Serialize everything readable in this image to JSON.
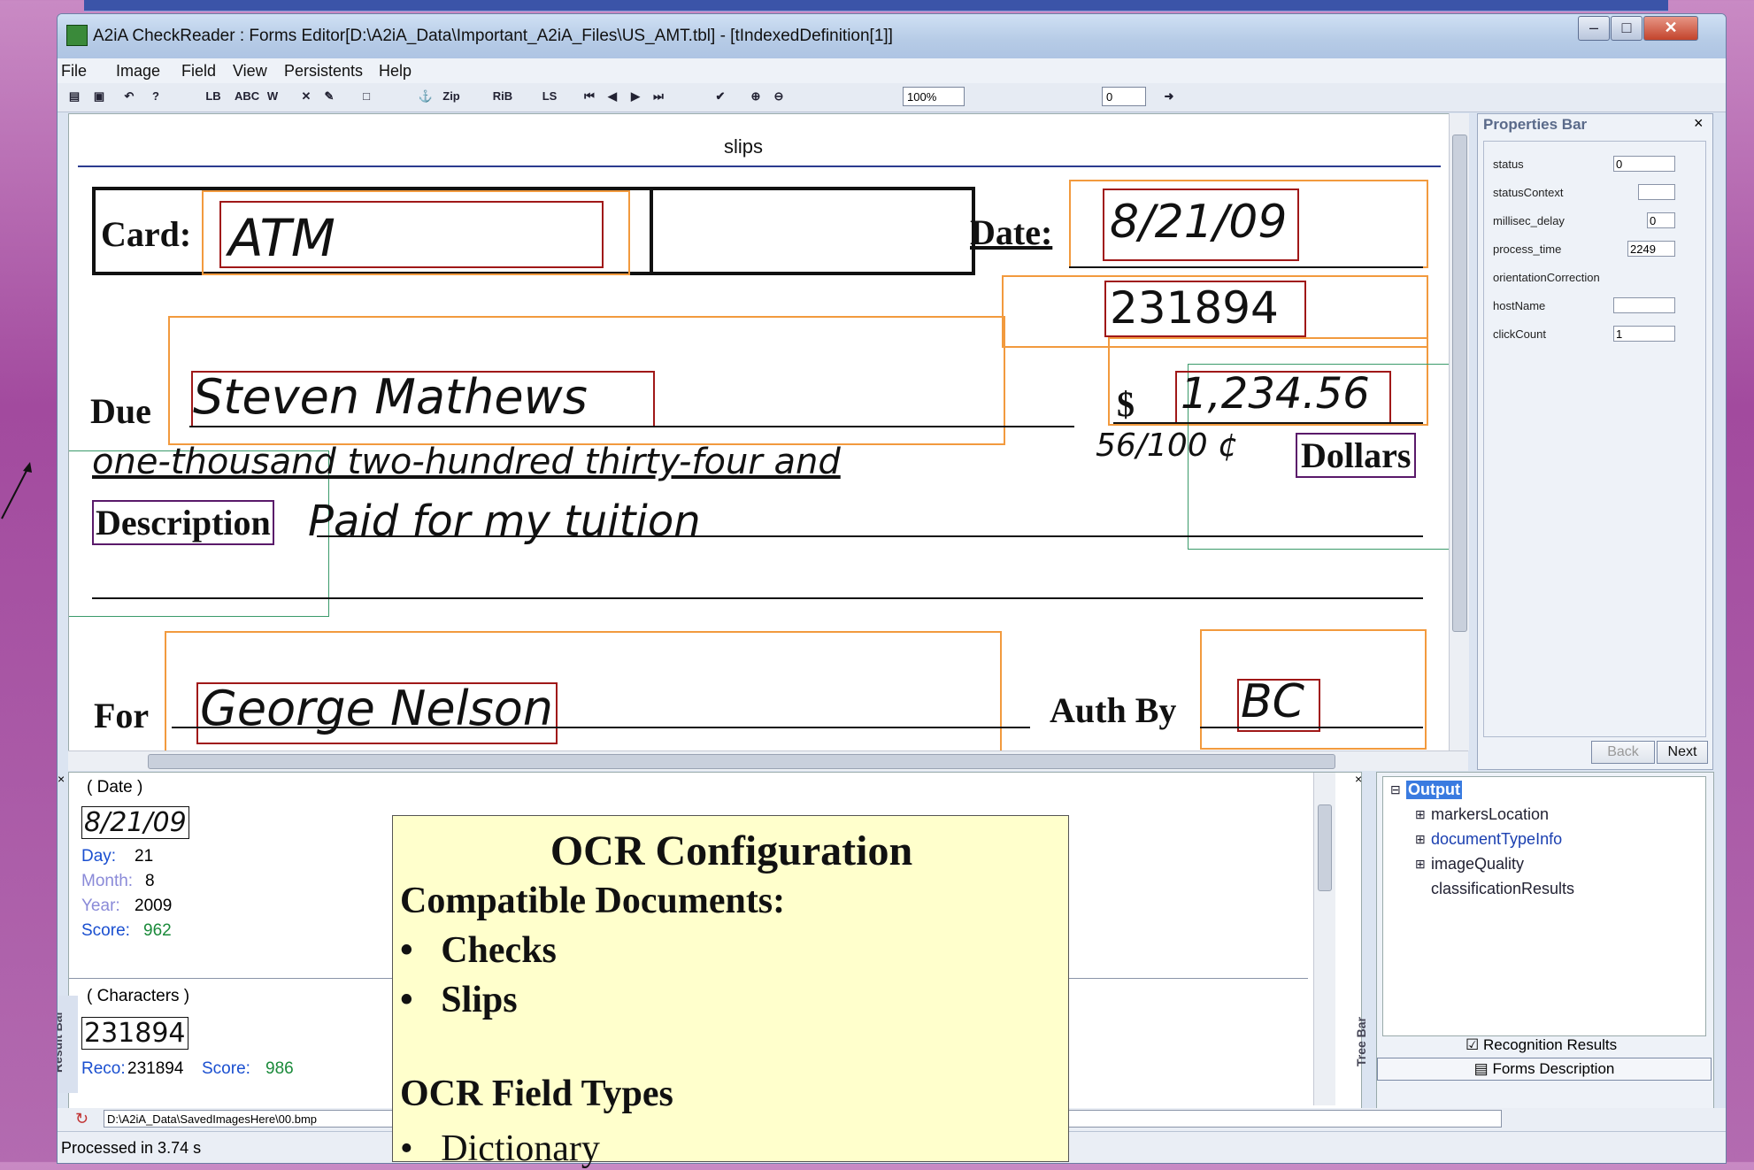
{
  "window": {
    "title": "A2iA CheckReader : Forms Editor[D:\\A2iA_Data\\Important_A2iA_Files\\US_AMT.tbl] - [tIndexedDefinition[1]]"
  },
  "menu": [
    "File",
    "Image",
    "Field",
    "View",
    "Persistents",
    "Help"
  ],
  "toolbar": {
    "zoom": "100%",
    "page": "0",
    "b1": "LB",
    "b2": "ABC",
    "b3": "Zip",
    "b4": "RiB",
    "b5": "LS"
  },
  "canvas": {
    "header": "slips",
    "card_label": "Card:",
    "card_value": "ATM",
    "date_label": "Date:",
    "date_value": "8/21/09",
    "serial_value": "231894",
    "due_label": "Due",
    "due_value": "Steven Mathews",
    "dollar_sign": "$",
    "amount_value": "1,234.56",
    "amount_words": "one-thousand two-hundred thirty-four and",
    "cents": "56/100 ¢",
    "dollars_label": "Dollars",
    "description_label": "Description",
    "description_value": "Paid for my tuition",
    "for_label": "For",
    "for_value": "George Nelson",
    "auth_label": "Auth By",
    "auth_value": "BC"
  },
  "properties": {
    "title": "Properties Bar",
    "rows": [
      {
        "name": "status",
        "value": "0"
      },
      {
        "name": "statusContext",
        "value": ""
      },
      {
        "name": "millisec_delay",
        "value": "0"
      },
      {
        "name": "process_time",
        "value": "2249"
      },
      {
        "name": "orientationCorrection",
        "value": ""
      },
      {
        "name": "hostName",
        "value": ""
      },
      {
        "name": "clickCount",
        "value": "1"
      }
    ],
    "back": "Back",
    "next": "Next"
  },
  "results": {
    "side_label": "Result Bar",
    "date_header": "( Date )",
    "date_image": "8/21/09",
    "day_label": "Day:",
    "day": "21",
    "month_label": "Month:",
    "month": "8",
    "year_label": "Year:",
    "year": "2009",
    "score_label": "Score:",
    "score": "962",
    "chars_header": "( Characters )",
    "chars_image": "231894",
    "reco_label": "Reco:",
    "reco": "231894",
    "score2_label": "Score:",
    "score2": "986"
  },
  "tree": {
    "side_label": "Tree Bar",
    "root": "Output",
    "items": [
      "markersLocation",
      "documentTypeInfo",
      "imageQuality",
      "classificationResults"
    ],
    "tab1": "Recognition Results",
    "tab2": "Forms Description"
  },
  "path": "D:\\A2iA_Data\\SavedImagesHere\\00.bmp",
  "status": "Processed in  3.74 s",
  "overlay": {
    "title": "OCR Configuration",
    "sub1": "Compatible Documents:",
    "doc1": "Checks",
    "doc2": "Slips",
    "sub2": "OCR Field Types",
    "field1": "Dictionary"
  },
  "colors": {
    "orange_box": "#f29a3e",
    "red_box": "#a01818",
    "green_box": "#3a9a6a",
    "accent_blue": "#1a4fd0"
  }
}
